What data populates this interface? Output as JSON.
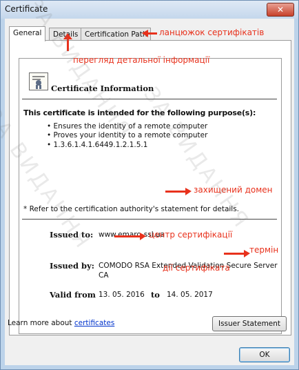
{
  "window": {
    "title": "Certificate",
    "close_glyph": "✕"
  },
  "tabs": [
    {
      "label": "General",
      "active": true
    },
    {
      "label": "Details",
      "active": false
    },
    {
      "label": "Certification Path",
      "active": false
    }
  ],
  "header": {
    "title": "Certificate Information"
  },
  "purpose": {
    "heading": "This certificate is intended for the following purpose(s):",
    "items": [
      "• Ensures the identity of a remote computer",
      "• Proves your identity to a remote computer",
      "• 1.3.6.1.4.1.6449.1.2.1.5.1"
    ]
  },
  "refer_note": "* Refer to the certification authority's statement for details.",
  "fields": {
    "issued_to_label": "Issued to:",
    "issued_to_value": "www.emaro-ssl.ua",
    "issued_by_label": "Issued by:",
    "issued_by_value_line1": "COMODO RSA Extended Validation Secure Server",
    "issued_by_value_line2": "CA",
    "valid_from_label": "Valid from",
    "valid_from_value": "13. 05. 2016",
    "valid_to_label": "to",
    "valid_to_value": "14. 05. 2017"
  },
  "buttons": {
    "issuer_statement": "Issuer Statement",
    "ok": "OK"
  },
  "learn_more": {
    "prefix": "Learn more about ",
    "link": "certificates"
  },
  "annotations": {
    "chain": "ланцюжок сертифікатів",
    "details": "перегляд детальної інформації",
    "domain": "захищений домен",
    "ca": "центр сертифікації",
    "term_line1": "термін",
    "term_line2": "дії сертифіката"
  },
  "colors": {
    "annotation": "#e8311c",
    "title_bar": "#c4d7ec",
    "link": "#0033cc"
  }
}
